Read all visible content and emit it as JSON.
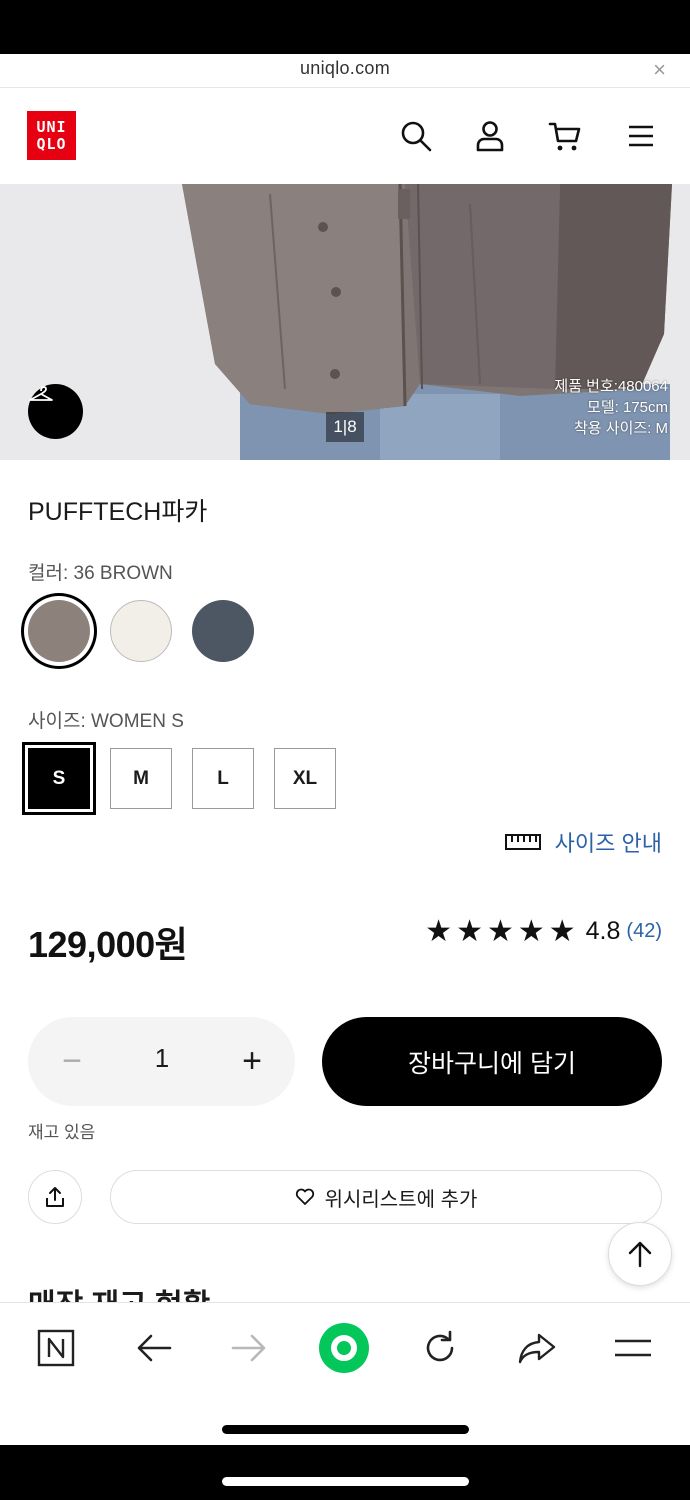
{
  "browser": {
    "url": "uniqlo.com",
    "close_symbol": "×"
  },
  "header": {
    "logo_line1": "UNI",
    "logo_line2": "QLO",
    "icons": [
      "search-icon",
      "account-icon",
      "cart-icon",
      "menu-icon"
    ]
  },
  "hero": {
    "image_counter": "1|8",
    "model_info": [
      "제품 번호:480064",
      "모델: 175cm",
      "착용 사이즈: M"
    ]
  },
  "product": {
    "name": "PUFFTECH파카",
    "color_label": "컬러: 36 BROWN",
    "colors": [
      {
        "hex": "#8d817c",
        "selected": true
      },
      {
        "hex": "#f1efe8",
        "selected": false
      },
      {
        "hex": "#4d5663",
        "selected": false
      }
    ],
    "size_label": "사이즈: WOMEN S",
    "sizes": [
      "S",
      "M",
      "L",
      "XL"
    ],
    "selected_size": "S",
    "size_guide": "사이즈 안내",
    "price": "129,000원",
    "stars": "★★★★★",
    "rating": "4.8",
    "review_count": "(42)"
  },
  "purchase": {
    "qty_minus": "−",
    "quantity": "1",
    "qty_plus": "+",
    "add_to_cart": "장바구니에 담기",
    "stock_status": "재고 있음",
    "wishlist": "위시리스트에 추가"
  },
  "section": {
    "store_stock_title": "매장 재고 현황"
  },
  "colors": {
    "brand_red": "#e60012",
    "link_blue": "#2b61a8",
    "accent_green": "#03c75a"
  },
  "browser_nav": {
    "icons": [
      "naver-n-icon",
      "back-arrow-icon",
      "forward-arrow-icon",
      "naver-home-icon",
      "refresh-icon",
      "share-icon",
      "menu-lines-icon"
    ]
  }
}
